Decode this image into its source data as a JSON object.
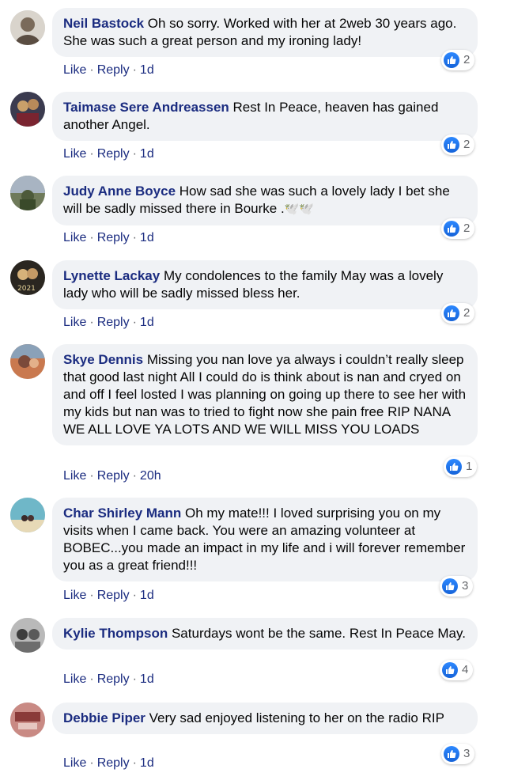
{
  "comments": [
    {
      "author": "Neil Bastock",
      "text": "Oh so sorry. Worked with her at 2web 30 years ago. She was such a great person and my ironing lady!",
      "like": "Like",
      "reply": "Reply",
      "time": "1d",
      "reactions": "2",
      "avatar_bg": "#d9d4cc",
      "avatar_fg": "#7a6a5a"
    },
    {
      "author": "Taimase Sere Andreassen",
      "text": "Rest In Peace, heaven has gained another Angel.",
      "like": "Like",
      "reply": "Reply",
      "time": "1d",
      "reactions": "2",
      "avatar_bg": "#3b3b4f",
      "avatar_fg": "#c9a06a"
    },
    {
      "author": "Judy Anne Boyce",
      "text": "How sad she was such a lovely lady I bet she will be sadly missed there in Bourke .",
      "emojis": "🕊️🕊️",
      "like": "Like",
      "reply": "Reply",
      "time": "1d",
      "reactions": "2",
      "avatar_bg": "#6f7a5a",
      "avatar_fg": "#a8b4c2"
    },
    {
      "author": "Lynette Lackay",
      "text": "My condolences to the family May was a lovely lady who will be sadly missed bless her.",
      "like": "Like",
      "reply": "Reply",
      "time": "1d",
      "reactions": "2",
      "avatar_bg": "#2a2620",
      "avatar_fg": "#d6b27a",
      "avatar_label": "2021"
    },
    {
      "author": "Skye Dennis",
      "text": "Missing you nan love ya always i couldn’t really sleep that good last night All I could do is think about is nan and cryed on and off I feel losted I was planning on going up there to see her with my kids but nan was to tried to fight now she pain free RIP NANA\nWE ALL LOVE YA LOTS AND WE WILL MISS YOU LOADS",
      "like": "Like",
      "reply": "Reply",
      "time": "20h",
      "reactions": "1",
      "avatar_bg": "#c9794f",
      "avatar_fg": "#7b4a3a"
    },
    {
      "author": "Char Shirley Mann",
      "text": "Oh my mate!!! I loved surprising you on my visits when I came back. You were an amazing volunteer at BOBEC...you made an impact in my life and i will forever remember you as a great friend!!!",
      "like": "Like",
      "reply": "Reply",
      "time": "1d",
      "reactions": "3",
      "avatar_bg": "#6fb7c8",
      "avatar_fg": "#e7d9b6"
    },
    {
      "author": "Kylie Thompson",
      "text": "Saturdays wont be the same. Rest In Peace May.",
      "like": "Like",
      "reply": "Reply",
      "time": "1d",
      "reactions": "4",
      "avatar_bg": "#b9b9b9",
      "avatar_fg": "#3d3d3d"
    },
    {
      "author": "Debbie Piper",
      "text": "Very sad enjoyed listening to her on the radio RIP",
      "like": "Like",
      "reply": "Reply",
      "time": "1d",
      "reactions": "3",
      "avatar_bg": "#c98a84",
      "avatar_fg": "#8a3a38"
    }
  ],
  "colors": {
    "author": "#1b2c80",
    "bubble": "#f0f2f5",
    "like_blue": "#1877f2"
  },
  "icons": {
    "reaction": "thumbs-up-icon"
  }
}
